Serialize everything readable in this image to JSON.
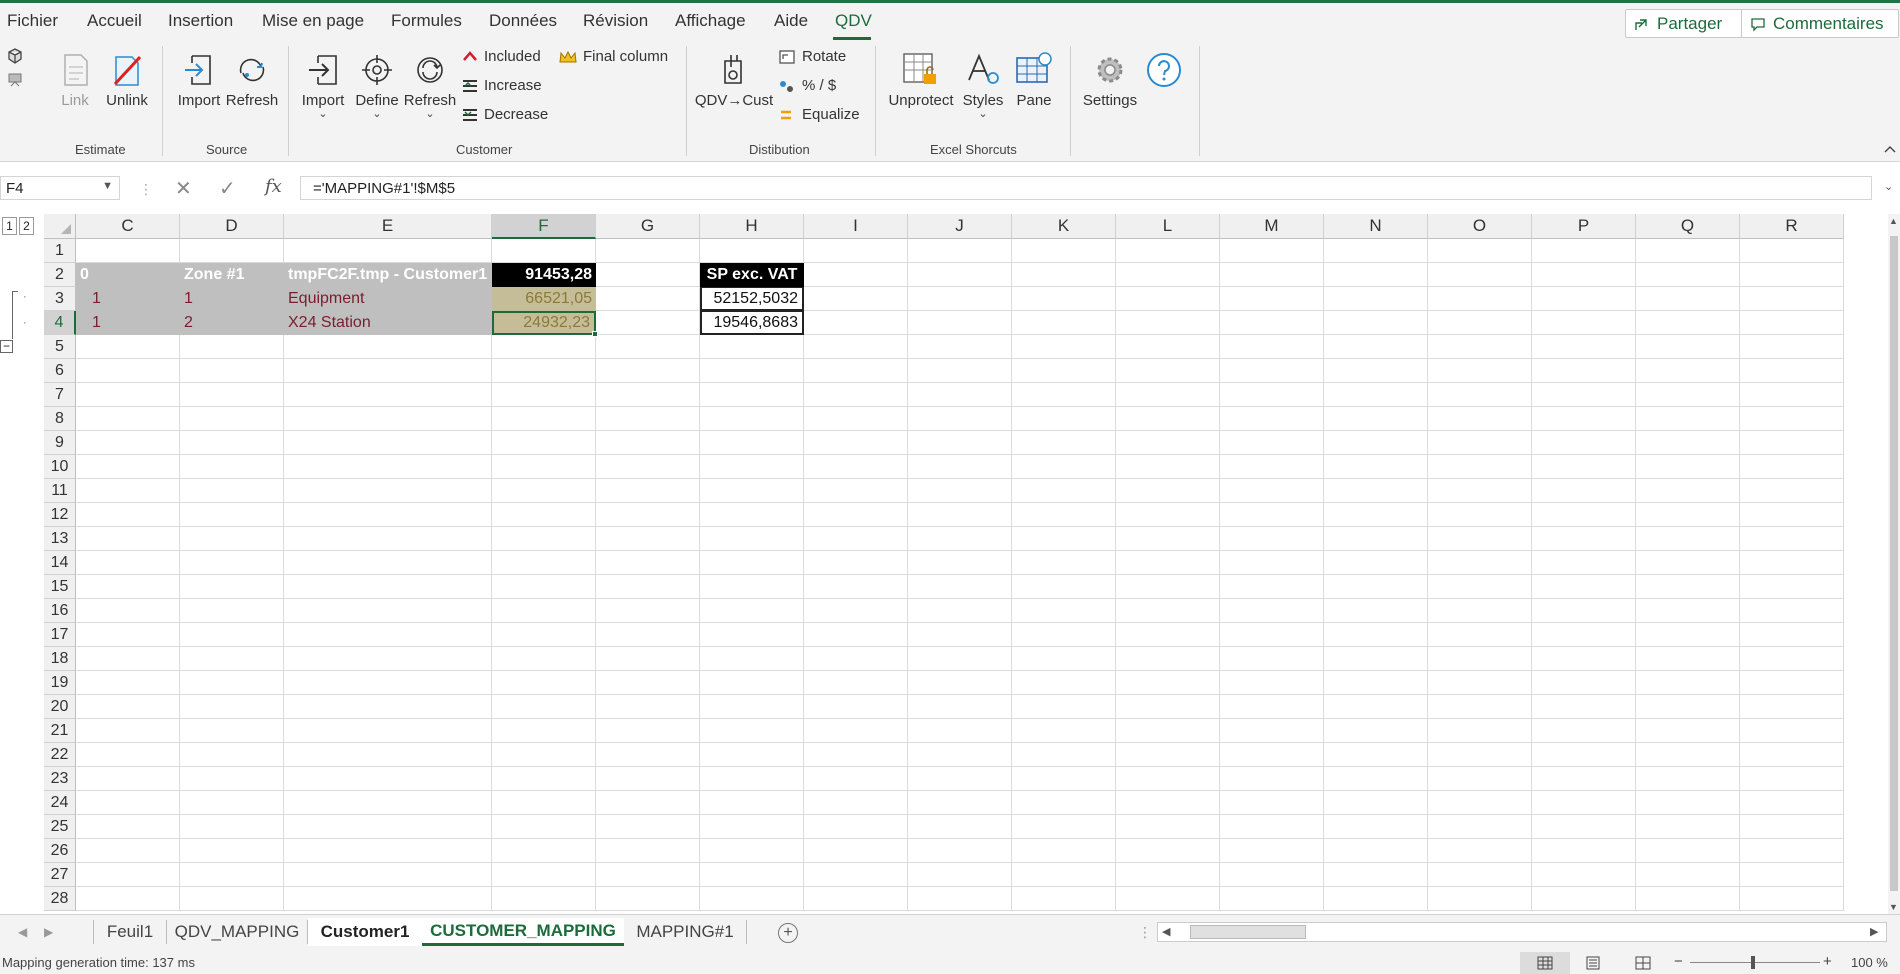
{
  "menu": {
    "items": [
      "Fichier",
      "Accueil",
      "Insertion",
      "Mise en page",
      "Formules",
      "Données",
      "Révision",
      "Affichage",
      "Aide",
      "QDV"
    ],
    "active": "QDV",
    "share_label": "Partager",
    "comments_label": "Commentaires"
  },
  "ribbon": {
    "estimate": {
      "label": "Estimate",
      "link": "Link",
      "unlink": "Unlink"
    },
    "source": {
      "label": "Source",
      "import": "Import",
      "refresh": "Refresh"
    },
    "customer": {
      "label": "Customer",
      "import": "Import",
      "define": "Define",
      "refresh": "Refresh",
      "included": "Included",
      "increase": "Increase",
      "decrease": "Decrease",
      "final_column": "Final column"
    },
    "distribution": {
      "label": "Distibution",
      "qdv_cust": "QDV→Cust",
      "rotate": "Rotate",
      "percent": "% / $",
      "equalize": "Equalize"
    },
    "shortcuts": {
      "label": "Excel Shorcuts",
      "unprotect": "Unprotect",
      "styles": "Styles",
      "pane": "Pane"
    },
    "settings": "Settings"
  },
  "formula_bar": {
    "name_box": "F4",
    "fx": "fx",
    "formula": "='MAPPING#1'!$M$5"
  },
  "outline_levels": [
    "1",
    "2"
  ],
  "columns": [
    "C",
    "D",
    "E",
    "F",
    "G",
    "H",
    "I",
    "J",
    "K",
    "L",
    "M",
    "N",
    "O",
    "P",
    "Q",
    "R"
  ],
  "selected_column": "F",
  "rows": [
    "1",
    "2",
    "3",
    "4",
    "5",
    "6",
    "7",
    "8",
    "9",
    "10",
    "11",
    "12",
    "13",
    "14",
    "15",
    "16",
    "17",
    "18",
    "19",
    "20",
    "21",
    "22",
    "23",
    "24",
    "25",
    "26",
    "27",
    "28"
  ],
  "selected_row": "4",
  "cells": {
    "C2": "0",
    "D2": "Zone #1",
    "E2": "tmpFC2F.tmp - Customer1",
    "F2": "91453,28",
    "H2": "SP exc. VAT",
    "C3": "1",
    "D3": "1",
    "E3": "Equipment",
    "F3": "66521,05",
    "H3": "52152,5032",
    "C4": "1",
    "D4": "2",
    "E4": "X24 Station",
    "F4": "24932,23",
    "H4": "19546,8683"
  },
  "sheet_tabs": [
    "Feuil1",
    "QDV_MAPPING",
    "Customer1",
    "CUSTOMER_MAPPING",
    "MAPPING#1"
  ],
  "active_sheet": "CUSTOMER_MAPPING",
  "status": {
    "message": "Mapping generation time: 137 ms",
    "zoom": "100 %",
    "zoom_out": "−",
    "zoom_in": "+"
  },
  "colors": {
    "accent": "#1d6b3b",
    "header_fill": "#000000",
    "gray_fill": "#bfbfbf",
    "olive_fill": "#c4bd97",
    "dark_red_text": "#7b1d2e"
  }
}
